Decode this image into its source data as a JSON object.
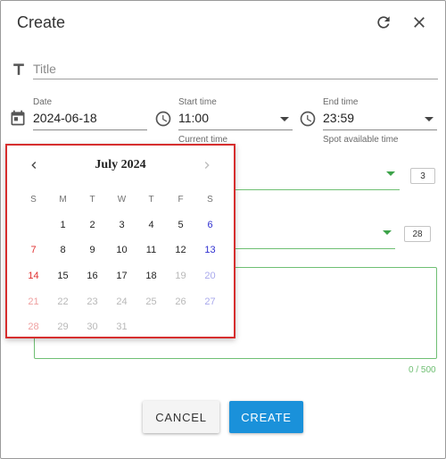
{
  "dialog": {
    "title": "Create",
    "refresh_icon": "refresh-icon",
    "close_icon": "close-icon"
  },
  "title_field": {
    "placeholder": "Title",
    "value": "",
    "icon": "text-format-icon"
  },
  "date_field": {
    "label": "Date",
    "value": "2024-06-18",
    "icon": "calendar-icon"
  },
  "start_time": {
    "label": "Start time",
    "value": "11:00",
    "helper": "Current time",
    "icon": "clock-icon"
  },
  "end_time": {
    "label": "End time",
    "value": "23:59",
    "helper": "Spot available time",
    "icon": "clock-icon"
  },
  "select_1": {
    "count": "3"
  },
  "select_2": {
    "count": "28"
  },
  "description": {
    "counter": "0 / 500"
  },
  "buttons": {
    "cancel": "CANCEL",
    "create": "CREATE"
  },
  "calendar": {
    "month_label": "July 2024",
    "weekdays": [
      "S",
      "M",
      "T",
      "W",
      "T",
      "F",
      "S"
    ],
    "weeks": [
      [
        {
          "d": "",
          "s": "empty"
        },
        {
          "d": "1",
          "s": ""
        },
        {
          "d": "2",
          "s": ""
        },
        {
          "d": "3",
          "s": ""
        },
        {
          "d": "4",
          "s": ""
        },
        {
          "d": "5",
          "s": ""
        },
        {
          "d": "6",
          "s": "sat"
        }
      ],
      [
        {
          "d": "7",
          "s": "sun"
        },
        {
          "d": "8",
          "s": ""
        },
        {
          "d": "9",
          "s": ""
        },
        {
          "d": "10",
          "s": ""
        },
        {
          "d": "11",
          "s": ""
        },
        {
          "d": "12",
          "s": ""
        },
        {
          "d": "13",
          "s": "sat"
        }
      ],
      [
        {
          "d": "14",
          "s": "sun"
        },
        {
          "d": "15",
          "s": ""
        },
        {
          "d": "16",
          "s": ""
        },
        {
          "d": "17",
          "s": ""
        },
        {
          "d": "18",
          "s": ""
        },
        {
          "d": "19",
          "s": "dis"
        },
        {
          "d": "20",
          "s": "sat-dis"
        }
      ],
      [
        {
          "d": "21",
          "s": "sun-dis"
        },
        {
          "d": "22",
          "s": "dis"
        },
        {
          "d": "23",
          "s": "dis"
        },
        {
          "d": "24",
          "s": "dis"
        },
        {
          "d": "25",
          "s": "dis"
        },
        {
          "d": "26",
          "s": "dis"
        },
        {
          "d": "27",
          "s": "sat-dis"
        }
      ],
      [
        {
          "d": "28",
          "s": "sun-dis"
        },
        {
          "d": "29",
          "s": "dis"
        },
        {
          "d": "30",
          "s": "dis"
        },
        {
          "d": "31",
          "s": "dis"
        },
        {
          "d": "",
          "s": "empty"
        },
        {
          "d": "",
          "s": "empty"
        },
        {
          "d": "",
          "s": "empty"
        }
      ]
    ]
  },
  "colors": {
    "accent_green": "#6fbf73",
    "primary_blue": "#1a91da",
    "sunday_red": "#e03030",
    "saturday_blue": "#2f2fd0",
    "highlight_border": "#d62e2e"
  }
}
